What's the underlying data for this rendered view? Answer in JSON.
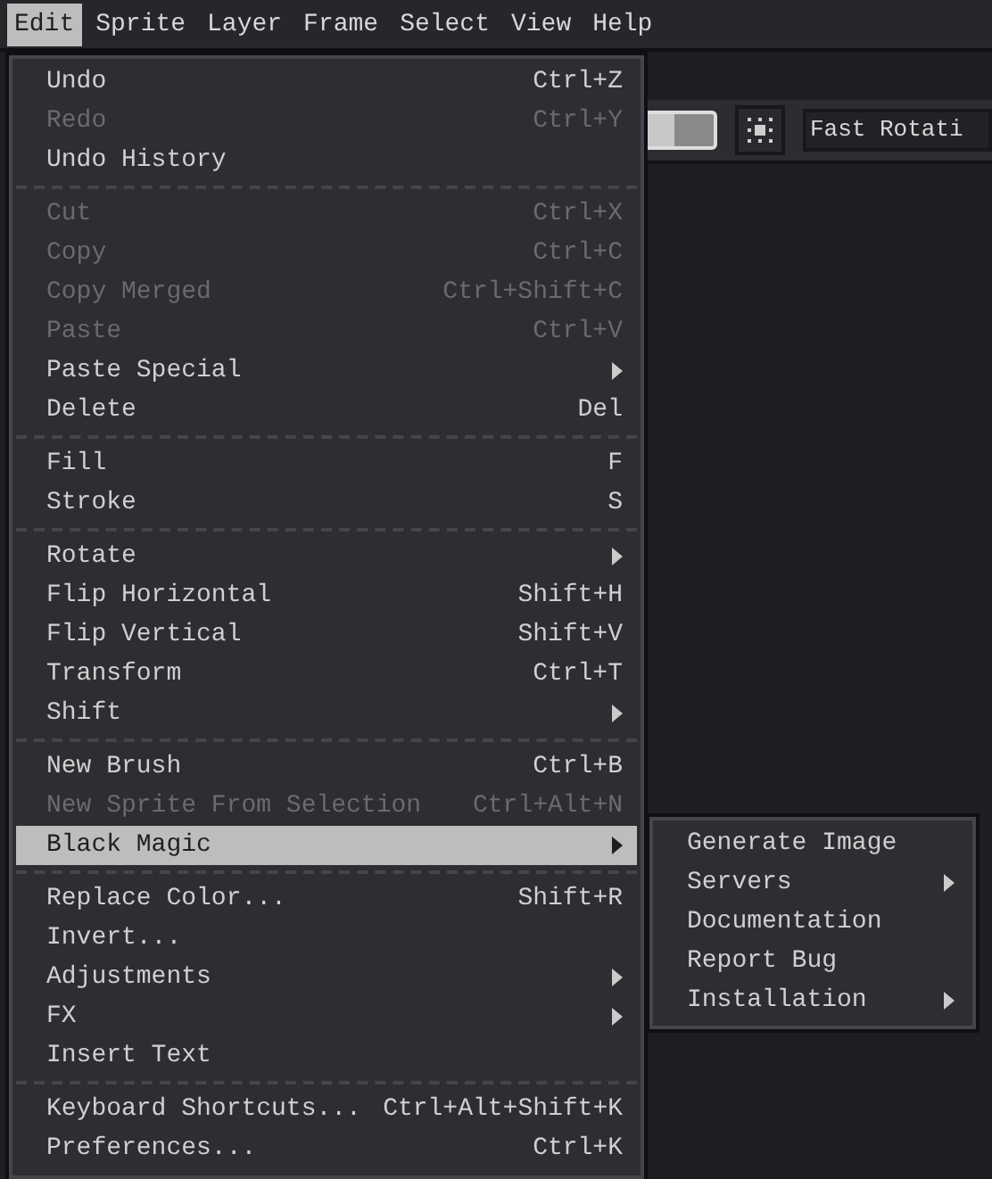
{
  "menubar": [
    {
      "label": "Edit",
      "selected": true
    },
    {
      "label": "Sprite",
      "selected": false
    },
    {
      "label": "Layer",
      "selected": false
    },
    {
      "label": "Frame",
      "selected": false
    },
    {
      "label": "Select",
      "selected": false
    },
    {
      "label": "View",
      "selected": false
    },
    {
      "label": "Help",
      "selected": false
    }
  ],
  "toolbar": {
    "rotation_field": "Fast Rotati"
  },
  "menu": {
    "groups": [
      [
        {
          "label": "Undo",
          "shortcut": "Ctrl+Z",
          "disabled": false,
          "selected": false
        },
        {
          "label": "Redo",
          "shortcut": "Ctrl+Y",
          "disabled": true,
          "selected": false
        },
        {
          "label": "Undo History",
          "disabled": false,
          "selected": false
        }
      ],
      [
        {
          "label": "Cut",
          "shortcut": "Ctrl+X",
          "disabled": true,
          "selected": false
        },
        {
          "label": "Copy",
          "shortcut": "Ctrl+C",
          "disabled": true,
          "selected": false
        },
        {
          "label": "Copy Merged",
          "shortcut": "Ctrl+Shift+C",
          "disabled": true,
          "selected": false
        },
        {
          "label": "Paste",
          "shortcut": "Ctrl+V",
          "disabled": true,
          "selected": false
        },
        {
          "label": "Paste Special",
          "disabled": false,
          "submenu": true,
          "selected": false
        },
        {
          "label": "Delete",
          "shortcut": "Del",
          "disabled": false,
          "selected": false
        }
      ],
      [
        {
          "label": "Fill",
          "shortcut": "F",
          "disabled": false,
          "selected": false
        },
        {
          "label": "Stroke",
          "shortcut": "S",
          "disabled": false,
          "selected": false
        }
      ],
      [
        {
          "label": "Rotate",
          "disabled": false,
          "submenu": true,
          "selected": false
        },
        {
          "label": "Flip Horizontal",
          "shortcut": "Shift+H",
          "disabled": false,
          "selected": false
        },
        {
          "label": "Flip Vertical",
          "shortcut": "Shift+V",
          "disabled": false,
          "selected": false
        },
        {
          "label": "Transform",
          "shortcut": "Ctrl+T",
          "disabled": false,
          "selected": false
        },
        {
          "label": "Shift",
          "disabled": false,
          "submenu": true,
          "selected": false
        }
      ],
      [
        {
          "label": "New Brush",
          "shortcut": "Ctrl+B",
          "disabled": false,
          "selected": false
        },
        {
          "label": "New Sprite From Selection",
          "shortcut": "Ctrl+Alt+N",
          "disabled": true,
          "selected": false
        },
        {
          "label": "Black Magic",
          "disabled": false,
          "submenu": true,
          "selected": true
        }
      ],
      [
        {
          "label": "Replace Color...",
          "shortcut": "Shift+R",
          "disabled": false,
          "selected": false
        },
        {
          "label": "Invert...",
          "disabled": false,
          "selected": false
        },
        {
          "label": "Adjustments",
          "disabled": false,
          "submenu": true,
          "selected": false
        },
        {
          "label": "FX",
          "disabled": false,
          "submenu": true,
          "selected": false
        },
        {
          "label": "Insert Text",
          "disabled": false,
          "selected": false
        }
      ],
      [
        {
          "label": "Keyboard Shortcuts...",
          "shortcut": "Ctrl+Alt+Shift+K",
          "disabled": false,
          "selected": false
        },
        {
          "label": "Preferences...",
          "shortcut": "Ctrl+K",
          "disabled": false,
          "selected": false
        }
      ]
    ]
  },
  "submenu": {
    "items": [
      {
        "label": "Generate Image"
      },
      {
        "label": "Servers",
        "submenu": true
      },
      {
        "label": "Documentation"
      },
      {
        "label": "Report Bug"
      },
      {
        "label": "Installation",
        "submenu": true
      }
    ]
  }
}
